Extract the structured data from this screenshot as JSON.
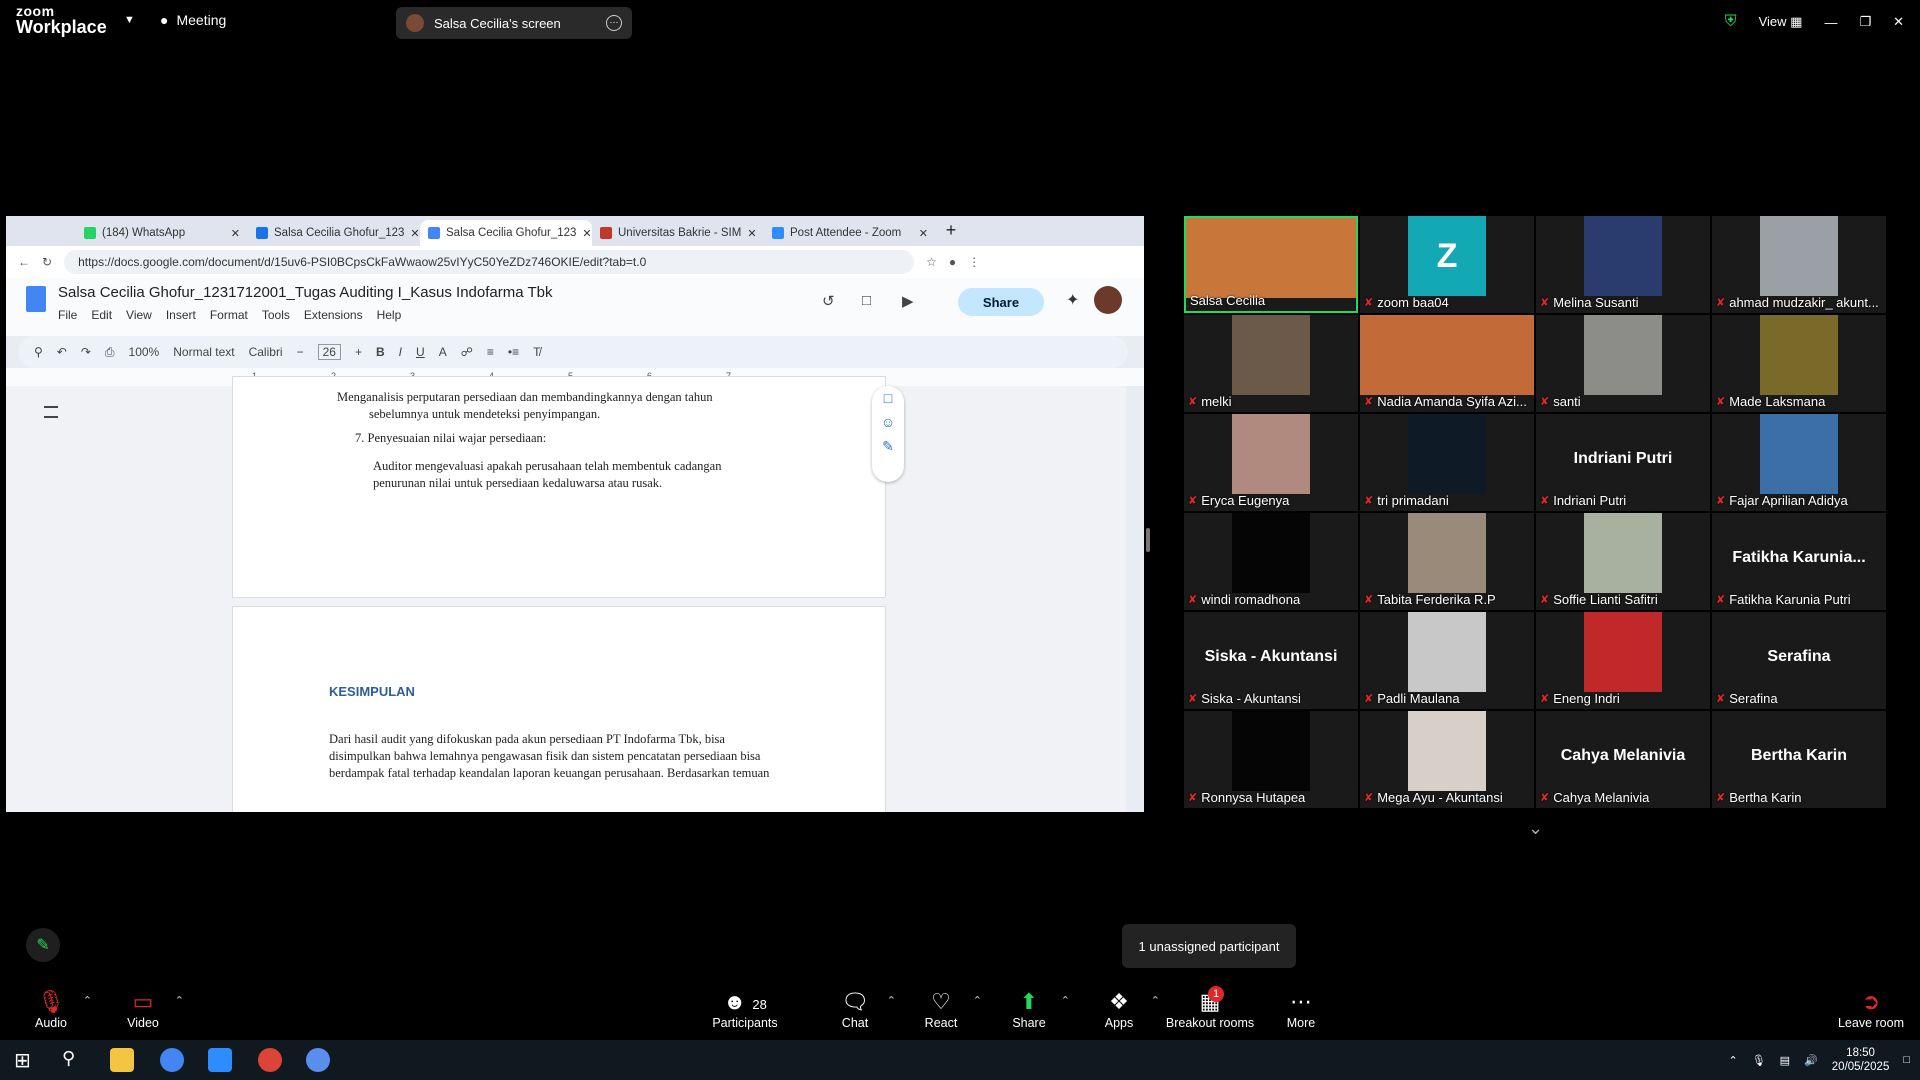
{
  "zoom": {
    "logo_line1": "zoom",
    "logo_line2": "Workplace",
    "meeting_label": "Meeting",
    "screen_share_label": "Salsa Cecilia's screen",
    "view_label": "View"
  },
  "browser": {
    "tabs": [
      {
        "label": "(184) WhatsApp",
        "color": "#25d366"
      },
      {
        "label": "Salsa Cecilia Ghofur_123",
        "color": "#1a73e8"
      },
      {
        "label": "Salsa Cecilia Ghofur_123",
        "color": "#4285f4"
      },
      {
        "label": "Universitas Bakrie - SIM",
        "color": "#c0392b"
      },
      {
        "label": "Post Attendee - Zoom",
        "color": "#2d8cff"
      }
    ],
    "url": "https://docs.google.com/document/d/15uv6-PSI0BCpsCkFaWwaow25vIYyC50YeZDz746OKIE/edit?tab=t.0"
  },
  "docs": {
    "title": "Salsa Cecilia Ghofur_1231712001_Tugas Auditing I_Kasus Indofarma Tbk",
    "menu": [
      "File",
      "Edit",
      "View",
      "Insert",
      "Format",
      "Tools",
      "Extensions",
      "Help"
    ],
    "share_label": "Share",
    "zoom": "100%",
    "style": "Normal text",
    "font": "Calibri",
    "font_size": "26",
    "ruler": [
      "1",
      "2",
      "3",
      "4",
      "5",
      "6",
      "7"
    ],
    "para1_line1": "Menganalisis perputaran persediaan dan membandingkannya dengan tahun",
    "para1_line2": "sebelumnya untuk mendeteksi penyimpangan.",
    "item7": "7. Penyesuaian nilai wajar persediaan:",
    "para2_line1": "Auditor mengevaluasi apakah perusahaan telah membentuk cadangan",
    "para2_line2": "penurunan nilai untuk persediaan kedaluwarsa atau rusak.",
    "heading": "KESIMPULAN",
    "para3_line1": "Dari hasil audit yang difokuskan pada akun persediaan PT Indofarma Tbk, bisa",
    "para3_line2": "disimpulkan bahwa lemahnya pengawasan fisik dan sistem pencatatan persediaan bisa",
    "para3_line3": "berdampak fatal terhadap keandalan laporan keuangan perusahaan. Berdasarkan temuan"
  },
  "participants": [
    {
      "name": "Salsa Cecilia",
      "kind": "video",
      "color": "#c8763a",
      "muted": false
    },
    {
      "name": "zoom baa04",
      "kind": "avatar",
      "letter": "Z",
      "color": "#12a9b4",
      "muted": true
    },
    {
      "name": "Melina Susanti",
      "kind": "video",
      "color": "#2a3b6e",
      "muted": true
    },
    {
      "name": "ahmad mudzakir_ akunt...",
      "kind": "video",
      "color": "#9aa0a6",
      "muted": true
    },
    {
      "name": "melki",
      "kind": "video",
      "color": "#6b5a4a",
      "muted": true
    },
    {
      "name": "Nadia Amanda Syifa Azi...",
      "kind": "video",
      "color": "#c26a38",
      "muted": true
    },
    {
      "name": "santi",
      "kind": "video",
      "color": "#8c8c88",
      "muted": true
    },
    {
      "name": "Made Laksmana",
      "kind": "video",
      "color": "#7a6a2a",
      "muted": true
    },
    {
      "name": "Eryca Eugenya",
      "kind": "video",
      "color": "#b08a7e",
      "muted": true
    },
    {
      "name": "tri primadani",
      "kind": "video",
      "color": "#0e1a26",
      "muted": true
    },
    {
      "name": "Indriani Putri",
      "kind": "name",
      "muted": true
    },
    {
      "name": "Fajar Aprilian Adidya",
      "kind": "video",
      "color": "#3c6ea8",
      "muted": true
    },
    {
      "name": "windi romadhona",
      "kind": "video",
      "color": "#050505",
      "muted": true
    },
    {
      "name": "Tabita Ferderika R.P",
      "kind": "video",
      "color": "#9a8a7a",
      "muted": true
    },
    {
      "name": "Soffie Lianti Safitri",
      "kind": "video",
      "color": "#a8b0a0",
      "muted": true
    },
    {
      "name": "Fatikha Karunia Putri",
      "kind": "name",
      "big": "Fatikha  Karunia...",
      "muted": true
    },
    {
      "name": "Siska - Akuntansi",
      "kind": "name",
      "muted": true
    },
    {
      "name": "Padli Maulana",
      "kind": "video",
      "color": "#c8c8c8",
      "muted": true
    },
    {
      "name": "Eneng Indri",
      "kind": "video",
      "color": "#c0282a",
      "muted": true
    },
    {
      "name": "Serafina",
      "kind": "name",
      "muted": true
    },
    {
      "name": "Ronnysa Hutapea",
      "kind": "video",
      "color": "#050505",
      "muted": true
    },
    {
      "name": "Mega Ayu - Akuntansi",
      "kind": "video",
      "color": "#d8d0c8",
      "muted": true
    },
    {
      "name": "Cahya Melanivia",
      "kind": "name",
      "muted": true
    },
    {
      "name": "Bertha Karin",
      "kind": "name",
      "muted": true
    }
  ],
  "toast": "1 unassigned participant",
  "controls": {
    "audio": "Audio",
    "video": "Video",
    "participants": "Participants",
    "participants_count": "28",
    "chat": "Chat",
    "react": "React",
    "share": "Share",
    "apps": "Apps",
    "breakout": "Breakout rooms",
    "breakout_badge": "1",
    "more": "More",
    "leave": "Leave room"
  },
  "taskbar": {
    "time": "18:50",
    "date": "20/05/2025"
  },
  "colors": {
    "zoom_green": "#23d959",
    "zoom_bg": "#000000",
    "share_green": "#23d959",
    "muted_red": "#e02828"
  }
}
